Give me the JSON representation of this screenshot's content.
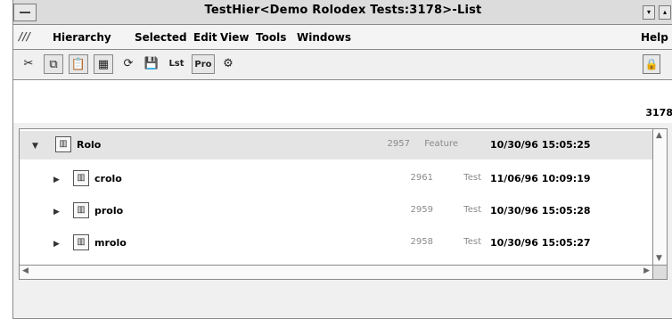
{
  "window": {
    "title": "TestHier<Demo Rolodex Tests:3178>-List",
    "min_glyph": "▾",
    "max_glyph": "▴"
  },
  "menu": {
    "icon_glyph": "///",
    "items": [
      {
        "label": "Hierarchy"
      },
      {
        "label": "Selected"
      },
      {
        "label": "Edit"
      },
      {
        "label": "View"
      },
      {
        "label": "Tools"
      },
      {
        "label": "Windows"
      }
    ],
    "help": "Help"
  },
  "toolbar": {
    "buttons": [
      {
        "icon": "wand-icon",
        "glyph": "✂"
      },
      {
        "icon": "copy-icon",
        "glyph": "⧉"
      },
      {
        "icon": "paste-icon",
        "glyph": "📋"
      },
      {
        "icon": "grid-icon",
        "glyph": "▦"
      },
      {
        "icon": "refresh-icon",
        "glyph": "⟳"
      },
      {
        "icon": "save-icon",
        "glyph": "💾"
      },
      {
        "icon": "list-icon",
        "label": "Lst"
      },
      {
        "icon": "pro-icon",
        "label": "Pro"
      },
      {
        "icon": "run-icon",
        "glyph": "⚙"
      }
    ],
    "lock_glyph": "🔒"
  },
  "status": {
    "id_value": "3178"
  },
  "list": {
    "node_glyph": "▥",
    "expanded_glyph": "▼",
    "collapsed_glyph": "▶",
    "rows": [
      {
        "name": "Rolo",
        "num": "2957",
        "type": "Feature",
        "date": "10/30/96 15:05:25",
        "expanded": true
      },
      {
        "name": "crolo",
        "num": "2961",
        "type": "Test",
        "date": "11/06/96 10:09:19",
        "expanded": false
      },
      {
        "name": "prolo",
        "num": "2959",
        "type": "Test",
        "date": "10/30/96 15:05:28",
        "expanded": false
      },
      {
        "name": "mrolo",
        "num": "2958",
        "type": "Test",
        "date": "10/30/96 15:05:27",
        "expanded": false
      }
    ]
  }
}
